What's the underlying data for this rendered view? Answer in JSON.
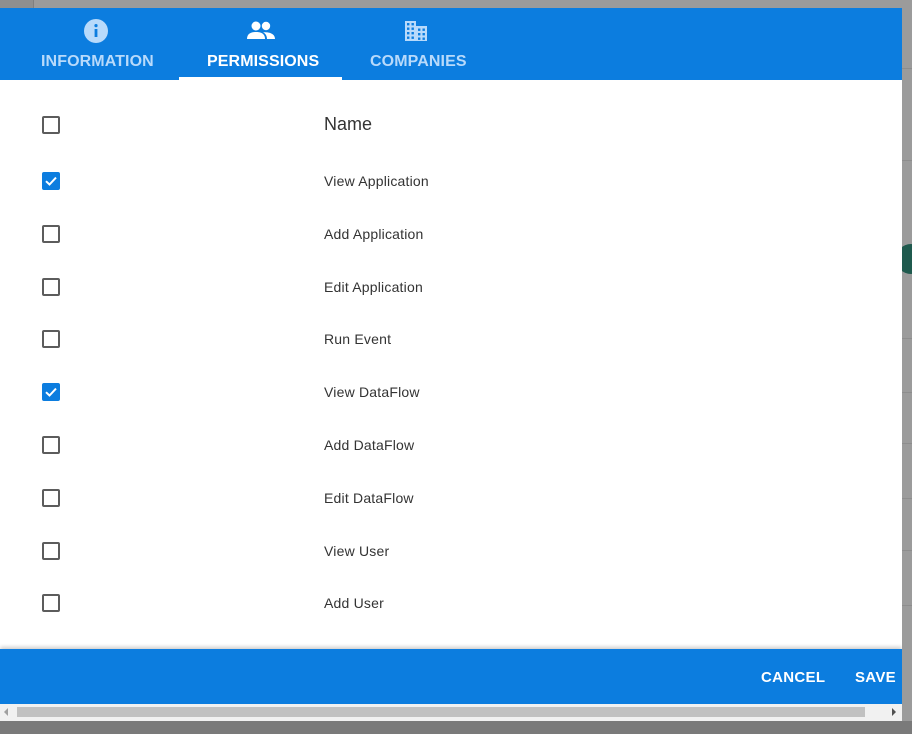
{
  "tabs": [
    {
      "label": "INFORMATION",
      "icon": "info-icon",
      "active": false
    },
    {
      "label": "PERMISSIONS",
      "icon": "people-icon",
      "active": true
    },
    {
      "label": "COMPANIES",
      "icon": "building-icon",
      "active": false
    }
  ],
  "table": {
    "header": "Name",
    "rows": [
      {
        "label": "View Application",
        "checked": true
      },
      {
        "label": "Add Application",
        "checked": false
      },
      {
        "label": "Edit Application",
        "checked": false
      },
      {
        "label": "Run Event",
        "checked": false
      },
      {
        "label": "View DataFlow",
        "checked": true
      },
      {
        "label": "Add DataFlow",
        "checked": false
      },
      {
        "label": "Edit DataFlow",
        "checked": false
      },
      {
        "label": "View User",
        "checked": false
      },
      {
        "label": "Add User",
        "checked": false
      }
    ]
  },
  "footer": {
    "cancel_label": "CANCEL",
    "save_label": "SAVE"
  },
  "colors": {
    "primary": "#0c7ddf",
    "tab_inactive_text": "#b8dafb",
    "tab_active_text": "#ffffff"
  }
}
